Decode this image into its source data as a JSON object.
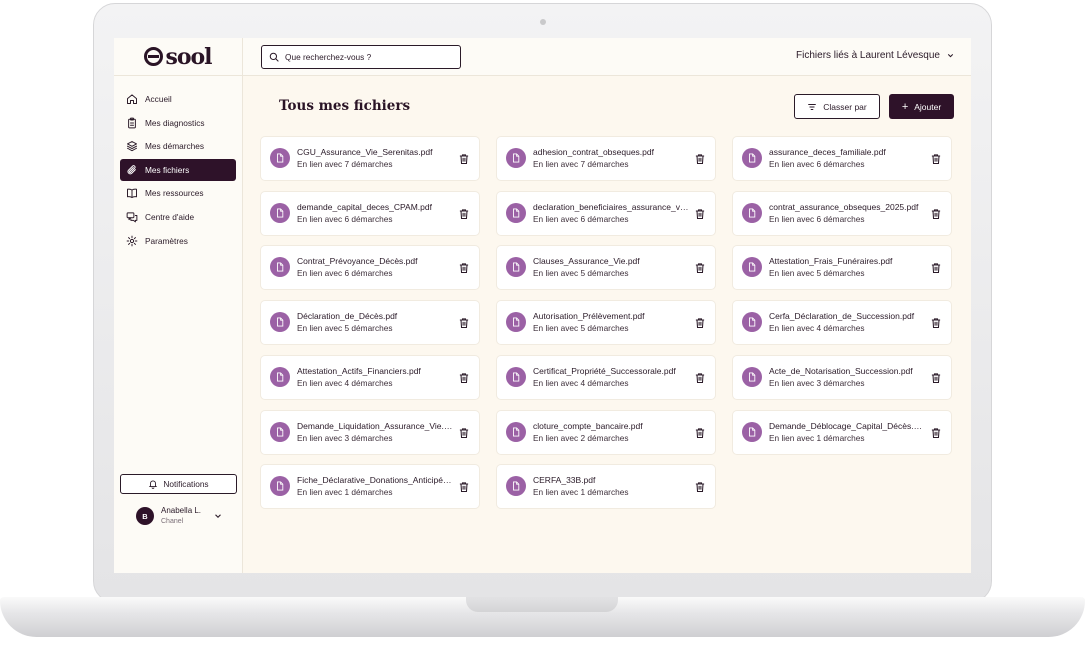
{
  "app": {
    "logo_text": "sool"
  },
  "sidebar": {
    "items": [
      {
        "label": "Accueil",
        "icon": "home-icon",
        "active": false
      },
      {
        "label": "Mes diagnostics",
        "icon": "clipboard-icon",
        "active": false
      },
      {
        "label": "Mes démarches",
        "icon": "layers-icon",
        "active": false
      },
      {
        "label": "Mes fichiers",
        "icon": "paperclip-icon",
        "active": true
      },
      {
        "label": "Mes ressources",
        "icon": "book-icon",
        "active": false
      },
      {
        "label": "Centre d'aide",
        "icon": "chat-icon",
        "active": false
      },
      {
        "label": "Paramètres",
        "icon": "gear-icon",
        "active": false
      }
    ],
    "notifications_label": "Notifications",
    "user": {
      "initial": "B",
      "name": "Anabella L.",
      "org": "Chanel"
    }
  },
  "topbar": {
    "search_placeholder": "Que recherchez-vous ?",
    "linked_label": "Fichiers liés à Laurent Lévesque"
  },
  "main": {
    "title": "Tous mes fichiers",
    "sort_label": "Classer par",
    "add_label": "Ajouter",
    "files": [
      {
        "name": "CGU_Assurance_Vie_Serenitas.pdf",
        "links": "En lien avec 7 démarches"
      },
      {
        "name": "adhesion_contrat_obseques.pdf",
        "links": "En lien avec 7 démarches"
      },
      {
        "name": "assurance_deces_familiale.pdf",
        "links": "En lien avec 6 démarches"
      },
      {
        "name": "demande_capital_deces_CPAM.pdf",
        "links": "En lien avec 6 démarches"
      },
      {
        "name": "declaration_beneficiaires_assurance_vie.pdf",
        "links": "En lien avec 6 démarches"
      },
      {
        "name": "contrat_assurance_obseques_2025.pdf",
        "links": "En lien avec 6 démarches"
      },
      {
        "name": "Contrat_Prévoyance_Décès.pdf",
        "links": "En lien avec 6 démarches"
      },
      {
        "name": "Clauses_Assurance_Vie.pdf",
        "links": "En lien avec 5 démarches"
      },
      {
        "name": "Attestation_Frais_Funéraires.pdf",
        "links": "En lien avec 5 démarches"
      },
      {
        "name": "Déclaration_de_Décès.pdf",
        "links": "En lien avec 5 démarches"
      },
      {
        "name": "Autorisation_Prélèvement.pdf",
        "links": "En lien avec 5 démarches"
      },
      {
        "name": "Cerfa_Déclaration_de_Succession.pdf",
        "links": "En lien avec 4 démarches"
      },
      {
        "name": "Attestation_Actifs_Financiers.pdf",
        "links": "En lien avec 4 démarches"
      },
      {
        "name": "Certificat_Propriété_Successorale.pdf",
        "links": "En lien avec 4 démarches"
      },
      {
        "name": "Acte_de_Notarisation_Succession.pdf",
        "links": "En lien avec 3 démarches"
      },
      {
        "name": "Demande_Liquidation_Assurance_Vie.pdf",
        "links": "En lien avec 3 démarches"
      },
      {
        "name": "cloture_compte_bancaire.pdf",
        "links": "En lien avec 2 démarches"
      },
      {
        "name": "Demande_Déblocage_Capital_Décès.pdf",
        "links": "En lien avec 1 démarches"
      },
      {
        "name": "Fiche_Déclarative_Donations_Anticipées.pdf",
        "links": "En lien avec 1 démarches"
      },
      {
        "name": "CERFA_33B.pdf",
        "links": "En lien avec 1 démarches"
      }
    ]
  },
  "colors": {
    "accent": "#2e1229",
    "file_icon": "#9b61a5",
    "background": "#fdf8ef"
  }
}
